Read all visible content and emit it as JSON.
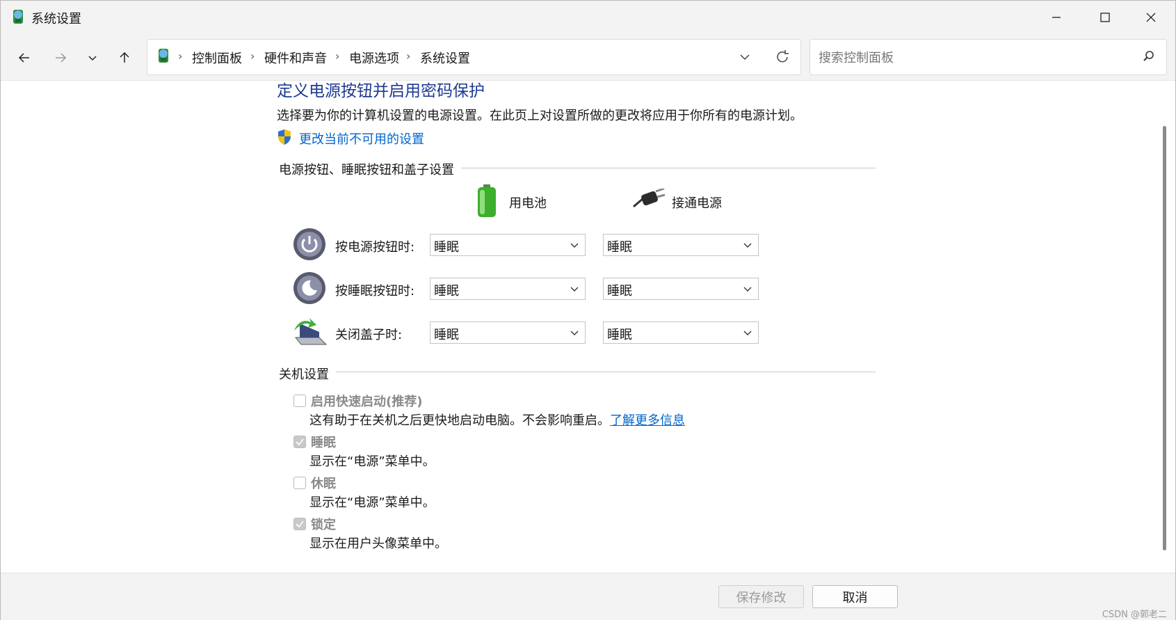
{
  "window": {
    "title": "系统设置"
  },
  "navigation": {
    "breadcrumbs": [
      "控制面板",
      "硬件和声音",
      "电源选项",
      "系统设置"
    ],
    "search_placeholder": "搜索控制面板"
  },
  "main": {
    "heading": "定义电源按钮并启用密码保护",
    "description": "选择要为你的计算机设置的电源设置。在此页上对设置所做的更改将应用于你所有的电源计划。",
    "change_link": "更改当前不可用的设置",
    "power_section": {
      "title": "电源按钮、睡眠按钮和盖子设置",
      "col_battery": "用电池",
      "col_plugged": "接通电源",
      "rows": [
        {
          "label": "按电源按钮时:",
          "battery": "睡眠",
          "plugged": "睡眠",
          "icon": "power-button-icon"
        },
        {
          "label": "按睡眠按钮时:",
          "battery": "睡眠",
          "plugged": "睡眠",
          "icon": "sleep-button-icon"
        },
        {
          "label": "关闭盖子时:",
          "battery": "睡眠",
          "plugged": "睡眠",
          "icon": "laptop-lid-icon"
        }
      ]
    },
    "shutdown_section": {
      "title": "关机设置",
      "items": [
        {
          "label": "启用快速启动(推荐)",
          "checked": false,
          "desc": "这有助于在关机之后更快地启动电脑。不会影响重启。",
          "link": "了解更多信息"
        },
        {
          "label": "睡眠",
          "checked": true,
          "desc": "显示在“电源”菜单中。"
        },
        {
          "label": "休眠",
          "checked": false,
          "desc": "显示在“电源”菜单中。"
        },
        {
          "label": "锁定",
          "checked": true,
          "desc": "显示在用户头像菜单中。"
        }
      ]
    }
  },
  "footer": {
    "save_label": "保存修改",
    "cancel_label": "取消",
    "watermark": "CSDN @郭老二"
  },
  "colors": {
    "heading": "#1e3a93",
    "link": "#0066cc",
    "disabled_text": "#8a8a8a"
  }
}
